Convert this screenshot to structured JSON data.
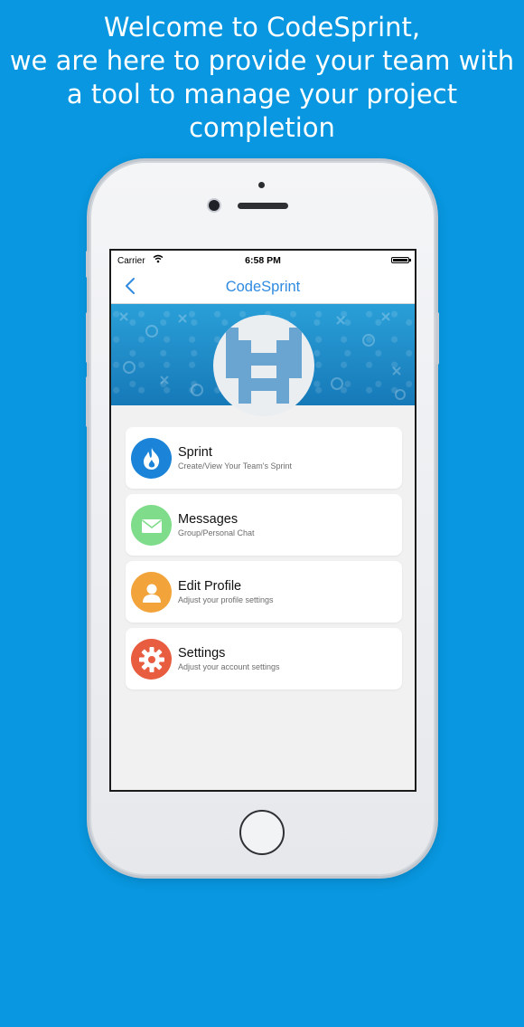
{
  "promo": {
    "headline": [
      "Welcome to CodeSprint,",
      "we are here to provide your team with",
      "a tool to manage your project",
      "completion"
    ]
  },
  "status_bar": {
    "carrier": "Carrier",
    "time": "6:58 PM"
  },
  "nav": {
    "title": "CodeSprint",
    "back_icon": "chevron-left-icon"
  },
  "menu": {
    "items": [
      {
        "title": "Sprint",
        "subtitle": "Create/View Your Team's Sprint",
        "icon": "fire-icon",
        "color": "#1b84d8"
      },
      {
        "title": "Messages",
        "subtitle": "Group/Personal Chat",
        "icon": "envelope-icon",
        "color": "#7fdc8a"
      },
      {
        "title": "Edit Profile",
        "subtitle": "Adjust your profile settings",
        "icon": "user-icon",
        "color": "#f2a33a"
      },
      {
        "title": "Settings",
        "subtitle": "Adjust your account settings",
        "icon": "gear-icon",
        "color": "#e85c3f"
      }
    ]
  },
  "colors": {
    "background": "#0897e0",
    "accent": "#2f8ae0"
  }
}
